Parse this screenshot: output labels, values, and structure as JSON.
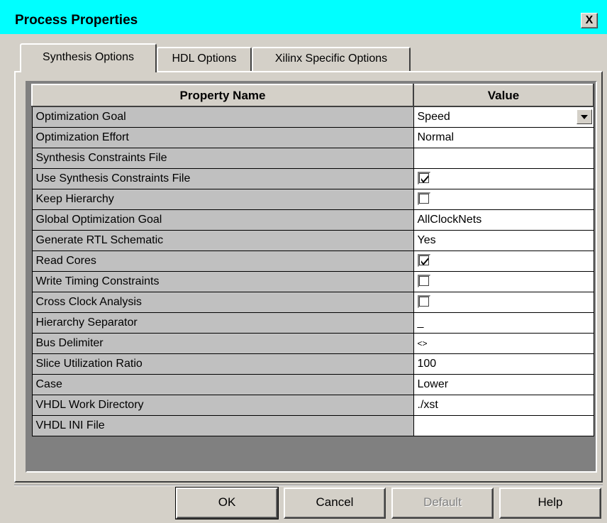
{
  "window": {
    "title": "Process Properties",
    "close_label": "X"
  },
  "tabs": [
    {
      "label": "Synthesis Options"
    },
    {
      "label": "HDL Options"
    },
    {
      "label": "Xilinx Specific Options"
    }
  ],
  "table": {
    "headers": {
      "name": "Property Name",
      "value": "Value"
    },
    "rows": [
      {
        "name": "Optimization Goal",
        "value": "Speed",
        "type": "dropdown"
      },
      {
        "name": "Optimization Effort",
        "value": "Normal",
        "type": "text"
      },
      {
        "name": "Synthesis Constraints File",
        "value": "",
        "type": "text"
      },
      {
        "name": "Use Synthesis Constraints File",
        "checked": true,
        "type": "checkbox"
      },
      {
        "name": "Keep Hierarchy",
        "checked": false,
        "type": "checkbox"
      },
      {
        "name": "Global Optimization Goal",
        "value": "AllClockNets",
        "type": "text"
      },
      {
        "name": "Generate RTL Schematic",
        "value": "Yes",
        "type": "text"
      },
      {
        "name": "Read Cores",
        "checked": true,
        "type": "checkbox"
      },
      {
        "name": "Write Timing Constraints",
        "checked": false,
        "type": "checkbox"
      },
      {
        "name": "Cross Clock Analysis",
        "checked": false,
        "type": "checkbox"
      },
      {
        "name": "Hierarchy Separator",
        "value": "_",
        "type": "text"
      },
      {
        "name": "Bus Delimiter",
        "value": "<>",
        "type": "text"
      },
      {
        "name": "Slice Utilization Ratio",
        "value": "100",
        "type": "text"
      },
      {
        "name": "Case",
        "value": "Lower",
        "type": "text"
      },
      {
        "name": "VHDL Work Directory",
        "value": "./xst",
        "type": "text"
      },
      {
        "name": "VHDL INI File",
        "value": "",
        "type": "text"
      }
    ]
  },
  "buttons": {
    "ok": "OK",
    "cancel": "Cancel",
    "default": "Default",
    "help": "Help"
  },
  "colors": {
    "titlebar": "#00ffff",
    "dialog_face": "#d4d0c8",
    "name_cell": "#c0c0c0"
  }
}
